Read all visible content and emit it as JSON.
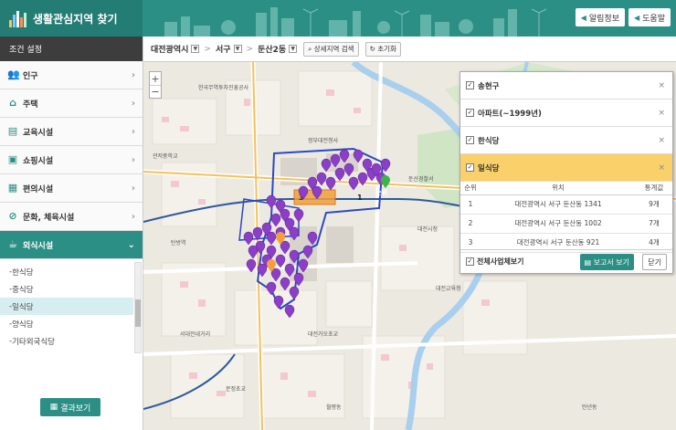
{
  "header": {
    "app_title": "생활관심지역 찾기",
    "buttons": [
      {
        "label": "알림정보",
        "icon": "chevron-left-icon"
      },
      {
        "label": "도움말",
        "icon": "chevron-left-icon"
      }
    ],
    "colors": {
      "primary": "#2b8f86",
      "brand_bg": "#247d75"
    }
  },
  "sidebar": {
    "title": "조건 설정",
    "categories": [
      {
        "label": "인구",
        "icon": "people-icon"
      },
      {
        "label": "주택",
        "icon": "house-icon"
      },
      {
        "label": "교육시설",
        "icon": "book-icon"
      },
      {
        "label": "쇼핑시설",
        "icon": "cart-icon"
      },
      {
        "label": "편의시설",
        "icon": "store-icon"
      },
      {
        "label": "문화, 체육시설",
        "icon": "ball-icon"
      },
      {
        "label": "외식시설",
        "icon": "cup-icon",
        "active": true
      }
    ],
    "subitems": [
      "한식당",
      "중식당",
      "일식당",
      "양식당",
      "기타외국식당"
    ],
    "selected_subitem": "일식당",
    "result_button": "결과보기"
  },
  "breadcrumb": {
    "city": "대전광역시",
    "district": "서구",
    "dong": "둔산2동",
    "detail_search": "상세지역 검색",
    "reset": "초기화"
  },
  "map": {
    "zoom_in": "+",
    "zoom_out": "−",
    "labels": [
      "한국무역투자진흥공사",
      "관저중학교",
      "정부대전청사",
      "둔산경찰서",
      "대전시청",
      "탄방역",
      "대전가오초교",
      "서대전네거리",
      "대전교육청",
      "문정초교",
      "월평동",
      "만년동"
    ],
    "marker_color": "#8b3fc7",
    "boundary_color": "#2a48c8"
  },
  "layer_panel": {
    "layers": [
      {
        "label": "송현구",
        "checked": true
      },
      {
        "label": "아파트(~1999년)",
        "checked": true
      },
      {
        "label": "한식당",
        "checked": true
      },
      {
        "label": "일식당",
        "checked": true,
        "highlighted": true
      }
    ],
    "table": {
      "headers": [
        "순위",
        "위치",
        "통계값"
      ],
      "rows": [
        [
          "1",
          "대전광역시 서구 둔산동 1341",
          "9개"
        ],
        [
          "2",
          "대전광역시 서구 둔산동 1002",
          "7개"
        ],
        [
          "3",
          "대전광역시 서구 둔산동 921",
          "4개"
        ]
      ]
    },
    "show_all_label": "전체사업체보기",
    "report_button": "보고서 보기",
    "close_button": "닫기"
  }
}
